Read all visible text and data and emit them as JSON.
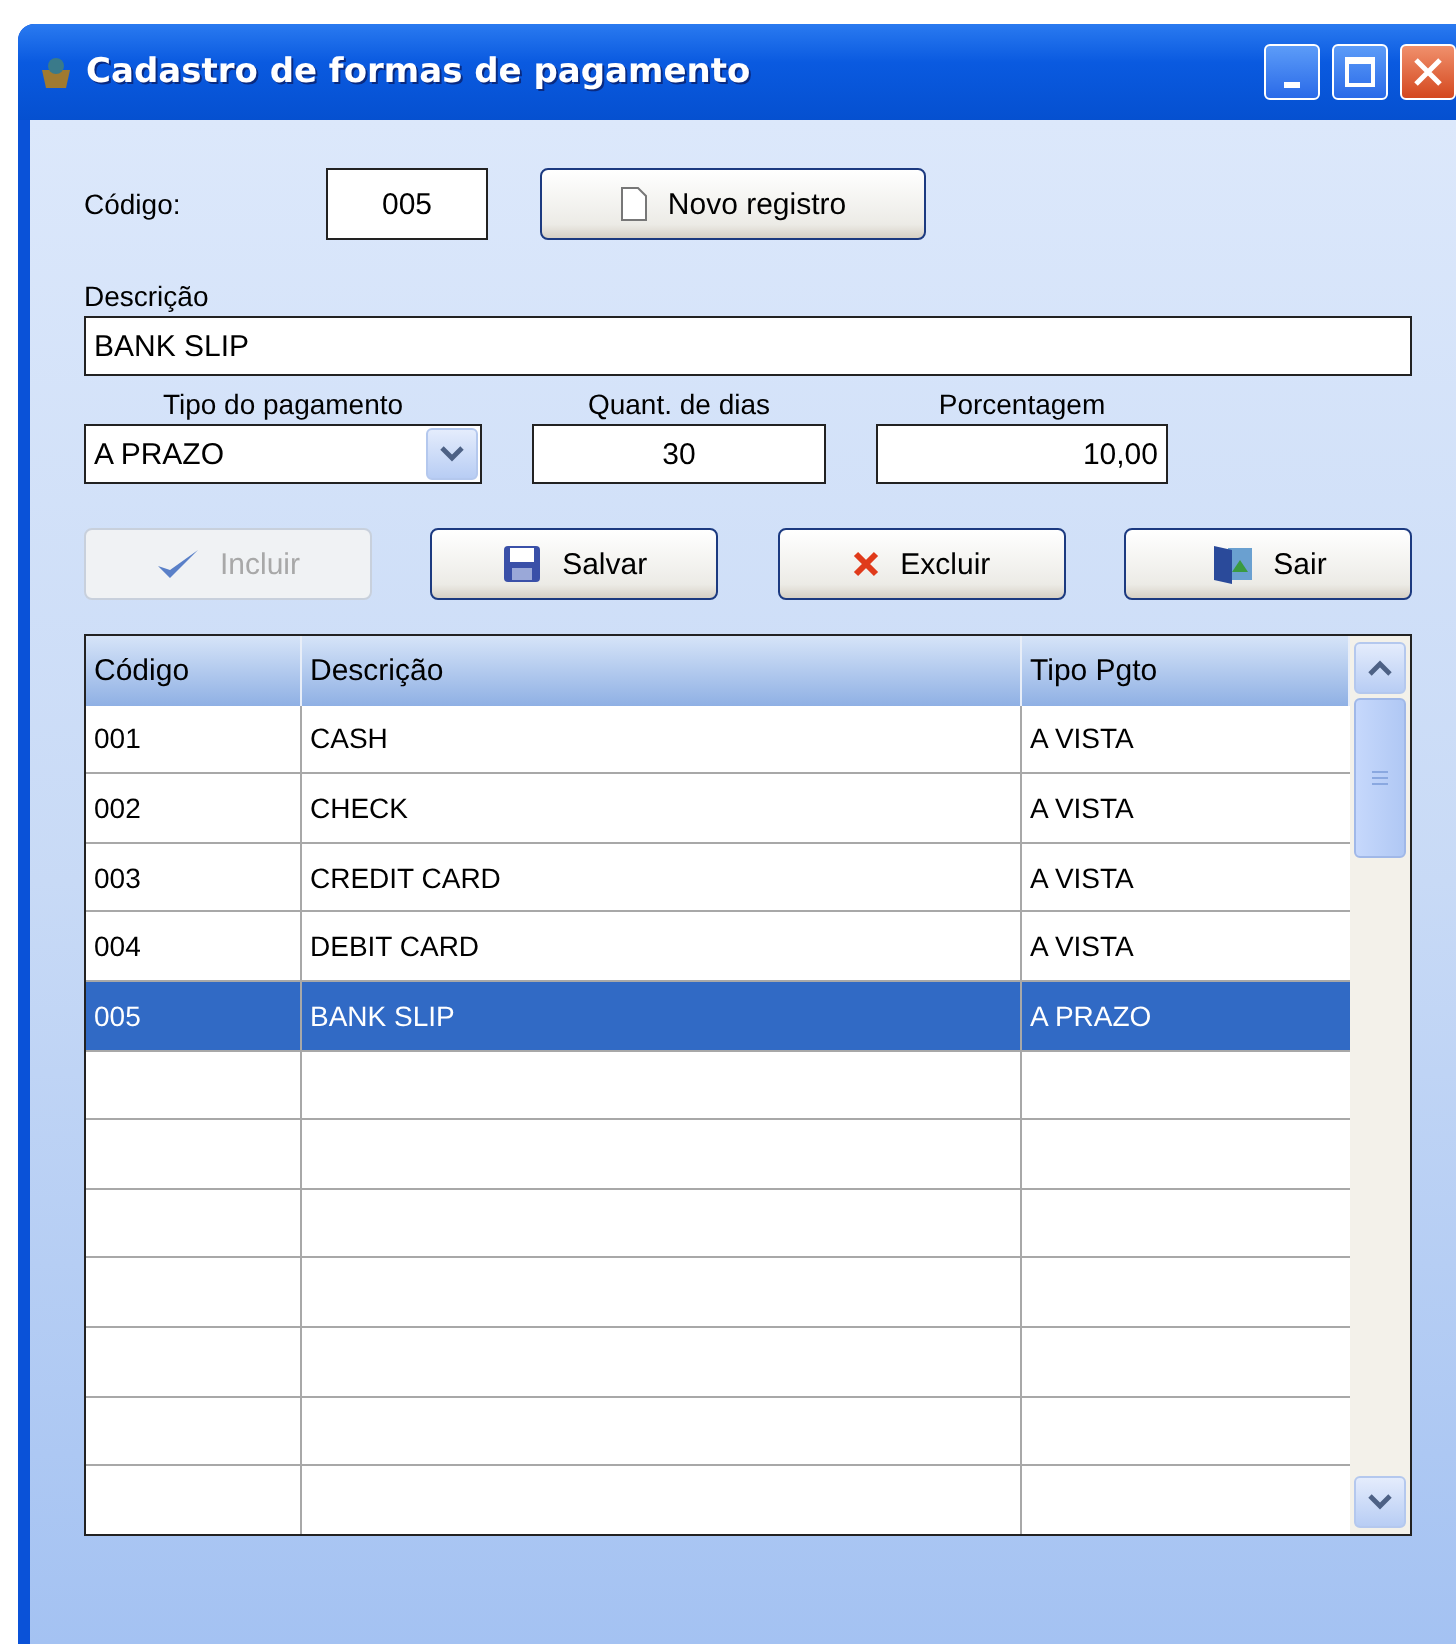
{
  "window": {
    "title": "Cadastro de formas de pagamento"
  },
  "form": {
    "codigo": {
      "label": "Código:",
      "value": "005"
    },
    "new_button": {
      "label": "Novo registro"
    },
    "descricao": {
      "label": "Descrição",
      "value": "BANK SLIP"
    },
    "tipo": {
      "label": "Tipo do pagamento",
      "value": "A PRAZO"
    },
    "dias": {
      "label": "Quant. de dias",
      "value": "30"
    },
    "porcentagem": {
      "label": "Porcentagem",
      "value": "10,00"
    }
  },
  "actions": [
    {
      "kind": "check",
      "label": "Incluir",
      "disabled": true
    },
    {
      "kind": "save",
      "label": "Salvar",
      "disabled": false
    },
    {
      "kind": "delete",
      "label": "Excluir",
      "disabled": false
    },
    {
      "kind": "exit",
      "label": "Sair",
      "disabled": false
    }
  ],
  "table": {
    "columns": [
      "Código",
      "Descrição",
      "Tipo Pgto"
    ],
    "rows": [
      {
        "cells": [
          "001",
          "CASH",
          "A VISTA"
        ],
        "selected": false
      },
      {
        "cells": [
          "002",
          "CHECK",
          "A VISTA"
        ],
        "selected": false
      },
      {
        "cells": [
          "003",
          "CREDIT CARD",
          "A VISTA"
        ],
        "selected": false
      },
      {
        "cells": [
          "004",
          "DEBIT CARD",
          "A VISTA"
        ],
        "selected": false
      },
      {
        "cells": [
          "005",
          "BANK SLIP",
          "A PRAZO"
        ],
        "selected": true
      }
    ]
  }
}
